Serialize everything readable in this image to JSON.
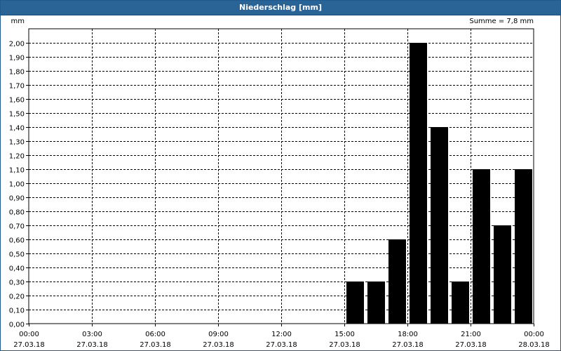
{
  "window": {
    "title": "Niederschlag [mm]"
  },
  "chart_data": {
    "type": "bar",
    "title": "Niederschlag [mm]",
    "ylabel": "mm",
    "sum_label": "Summe = 7,8 mm",
    "ylim": [
      0,
      2.1
    ],
    "grid": true,
    "y_ticks": [
      "0,00",
      "0,10",
      "0,20",
      "0,30",
      "0,40",
      "0,50",
      "0,60",
      "0,70",
      "0,80",
      "0,90",
      "1,00",
      "1,10",
      "1,20",
      "1,30",
      "1,40",
      "1,50",
      "1,60",
      "1,70",
      "1,80",
      "1,90",
      "2,00"
    ],
    "x_ticks": [
      {
        "time": "00:00",
        "date": "27.03.18"
      },
      {
        "time": "03:00",
        "date": "27.03.18"
      },
      {
        "time": "06:00",
        "date": "27.03.18"
      },
      {
        "time": "09:00",
        "date": "27.03.18"
      },
      {
        "time": "12:00",
        "date": "27.03.18"
      },
      {
        "time": "15:00",
        "date": "27.03.18"
      },
      {
        "time": "18:00",
        "date": "27.03.18"
      },
      {
        "time": "21:00",
        "date": "27.03.18"
      },
      {
        "time": "00:00",
        "date": "28.03.18"
      }
    ],
    "x_range_hours": [
      0,
      24
    ],
    "bar_width_hours": 1,
    "bars": [
      {
        "start_hour": 15,
        "value": 0.3
      },
      {
        "start_hour": 16,
        "value": 0.3
      },
      {
        "start_hour": 17,
        "value": 0.6
      },
      {
        "start_hour": 18,
        "value": 2.0
      },
      {
        "start_hour": 19,
        "value": 1.4
      },
      {
        "start_hour": 20,
        "value": 0.3
      },
      {
        "start_hour": 21,
        "value": 1.1
      },
      {
        "start_hour": 22,
        "value": 0.7
      },
      {
        "start_hour": 23,
        "value": 1.1
      }
    ],
    "bar_color": "#000000"
  }
}
